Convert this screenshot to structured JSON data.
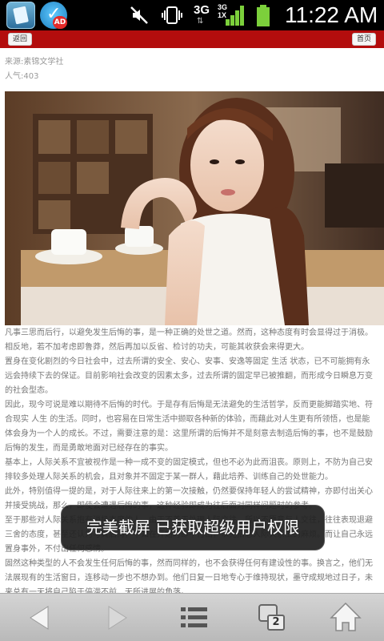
{
  "status_bar": {
    "time": "11:22 AM",
    "network": "3G",
    "signal_label": "3G\n1X",
    "badge": "AD",
    "icons": [
      "app-icon",
      "security-app-icon",
      "mute-icon",
      "vibrate-icon",
      "network-3g-icon",
      "signal-icon",
      "battery-icon"
    ]
  },
  "nav": {
    "back_label": "返回",
    "home_label": "首页"
  },
  "meta": {
    "source": "来源:素锦文学社",
    "views": "人气:403"
  },
  "article": {
    "paragraphs": [
      "凡事三思而后行，以避免发生后悔的事，是一种正确的处世之道。然而，这种态度有时会显得过于消极。相反地，若不加考虑即鲁莽，然后再加以反省、检讨的功夫，可能其收获会来得更大。",
      "置身在变化剧烈的今日社会中，过去所谓的安全、安心、安事、安逸等固定 生活 状态，已不可能拥有永远会持续下去的保证。目前影响社会改变的因素太多，过去所谓的固定早已被推翻，而形成今日瞬息万变的社会型态。",
      "因此，现今可说是难以期待不后悔的时代。于是存有后悔是无法避免的生活哲学，反而更能脚踏实地、符合现实 人生 的生活。同时，也容易在日常生活中撷取各种新的体验，而藉此对人生更有所领悟，也是能体会身为一个人的成长。不过，需要注意的是：这里所谓的后悔并不是刻意去制造后悔的事，也不是鼓励后悔的发生，而是勇敢地面对已经存在的事实。",
      "基本上，人际关系不宜被视作是一种一成不变的固定模式，但也不必为此而沮丧。原则上，不防为自己安排较多处理人际关系的机会，且对象并不固定于某一群人，藉此培养、训练自己的处世能力。",
      "此外，特别值得一提的是，对于人际往来上的第一次接触，仍然要保持年轻人的尝试精神，亦即付出关心并接受挑战，那么，即使会遭遇后悔的事，这种经验即成为往后面对同样问题时的参考。",
      "至于那些对人际关系抱有消极态度的人，由于不善于处理人际交往，所以不愿意与人交往，往往表现退避三舍的态度，甚至还认为与其后悔，不如在开始时即不付出，以免招惹人际关系上的麻烦。而让自己永远置身事外，不付出任何感情。",
      "固然这种类型的人不会发生任何后悔的事，然而同样的，也不会获得任何有建设性的事。换言之，他们无法展现有的生活窗日，连移动一步也不想办到。他们日复一日地专心于维持现状，墨守成规地过日子，未来总有一天将自己陷于停滞不前、无所进展的角落。"
    ]
  },
  "toast": {
    "message": "完美截屏 已获取超级用户权限"
  },
  "bottom_bar": {
    "tab_count": "2",
    "icons": [
      "back-arrow-icon",
      "forward-arrow-icon",
      "menu-icon",
      "tabs-icon",
      "home-icon"
    ]
  },
  "colors": {
    "nav_red": "#b30d0d",
    "status_bar": "#000000",
    "article_text": "#777777",
    "meta_text": "#999999",
    "bottom_bar": "#c8c8c8",
    "toast_bg": "#202020"
  }
}
